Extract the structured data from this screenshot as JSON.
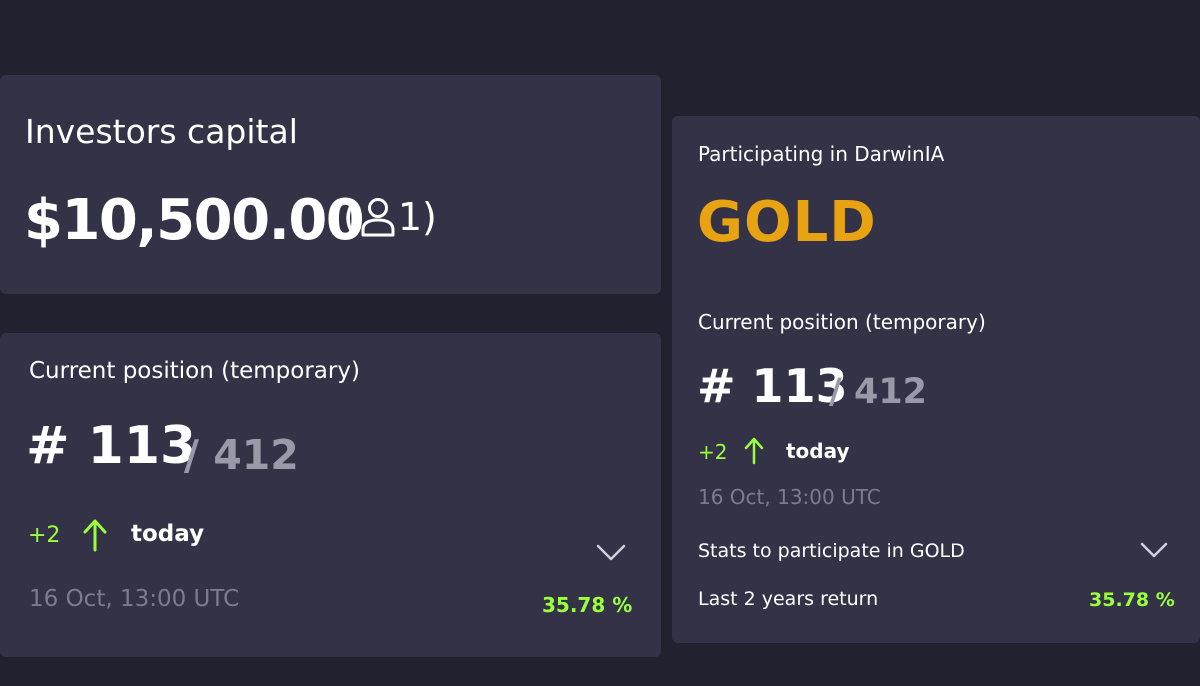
{
  "capital": {
    "title": "Investors capital",
    "amount": "$10,500.00",
    "open_paren": "(",
    "investors_count": "1",
    "close_paren": ")",
    "investor_icon": "user-icon"
  },
  "position_card": {
    "title": "Current position (temporary)",
    "rank": "# 113",
    "total": "/ 412",
    "change": "+2",
    "change_icon": "arrow-up-icon",
    "period": "today",
    "date": "16 Oct, 13:00 UTC",
    "return": "35.78 %",
    "expand_icon": "chevron-down-icon"
  },
  "darwinia_card": {
    "title": "Participating in DarwinIA",
    "level": "GOLD",
    "position_title": "Current position (temporary)",
    "rank": "# 113",
    "total": "/ 412",
    "change": "+2",
    "change_icon": "arrow-up-icon",
    "period": "today",
    "date": "16 Oct, 13:00 UTC",
    "stats_label": "Stats to participate in GOLD",
    "expand_icon": "chevron-down-icon",
    "return_label": "Last 2 years return",
    "return": "35.78 %"
  },
  "colors": {
    "background": "#22212f",
    "card": "#333247",
    "gold": "#e8a312",
    "positive": "#9cff3c",
    "muted": "#9a99a8"
  }
}
